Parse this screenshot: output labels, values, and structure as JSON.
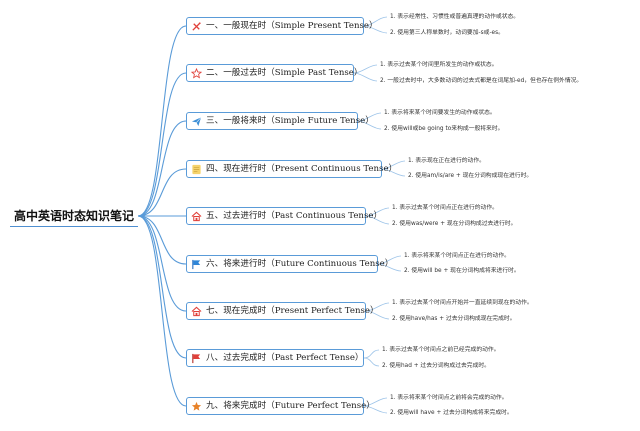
{
  "root": "高中英语时态知识笔记",
  "colors": {
    "line": "#5a9bd8",
    "leaf_line": "#9cc3e8"
  },
  "branches": [
    {
      "label": "一、一般现在时（Simple Present Tense）",
      "icon": "crossed-pencil-icon",
      "notes": [
        "1. 表示经常性、习惯性或普遍真理的动作或状态。",
        "2. 使用第三人称单数时，动词要加-s或-es。"
      ]
    },
    {
      "label": "二、一般过去时（Simple Past Tense）",
      "icon": "star-outline-icon",
      "notes": [
        "1. 表示过去某个时间里所发生的动作或状态。",
        "2. 一般过去时中，大多数动词的过去式都是在词尾加-ed，但也存在例外情况。"
      ]
    },
    {
      "label": "三、一般将来时（Simple Future Tense）",
      "icon": "paper-plane-icon",
      "notes": [
        "1. 表示将来某个时间要发生的动作或状态。",
        "2. 使用will或be going to来构成一般将来时。"
      ]
    },
    {
      "label": "四、现在进行时（Present Continuous Tense）",
      "icon": "note-icon",
      "notes": [
        "1. 表示现在正在进行的动作。",
        "2. 使用am/is/are + 现在分词构成现在进行时。"
      ]
    },
    {
      "label": "五、过去进行时（Past Continuous Tense）",
      "icon": "home-icon",
      "notes": [
        "1. 表示过去某个时间点正在进行的动作。",
        "2. 使用was/were + 现在分词构成过去进行时。"
      ]
    },
    {
      "label": "六、将来进行时（Future Continuous Tense）",
      "icon": "blue-flag-icon",
      "notes": [
        "1. 表示将来某个时间点正在进行的动作。",
        "2. 使用will be + 现在分词构成将来进行时。"
      ]
    },
    {
      "label": "七、现在完成时（Present Perfect Tense）",
      "icon": "home-icon",
      "notes": [
        "1. 表示过去某个时间点开始并一直延续到现在的动作。",
        "2. 使用have/has + 过去分词构成现在完成时。"
      ]
    },
    {
      "label": "八、过去完成时（Past Perfect Tense）",
      "icon": "red-flag-icon",
      "notes": [
        "1. 表示过去某个时间点之前已经完成的动作。",
        "2. 使用had + 过去分词构成过去完成时。"
      ]
    },
    {
      "label": "九、将来完成时（Future Perfect Tense）",
      "icon": "orange-star-icon",
      "notes": [
        "1. 表示将来某个时间点之前将会完成的动作。",
        "2. 使用will have + 过去分词构成将来完成时。"
      ]
    }
  ]
}
